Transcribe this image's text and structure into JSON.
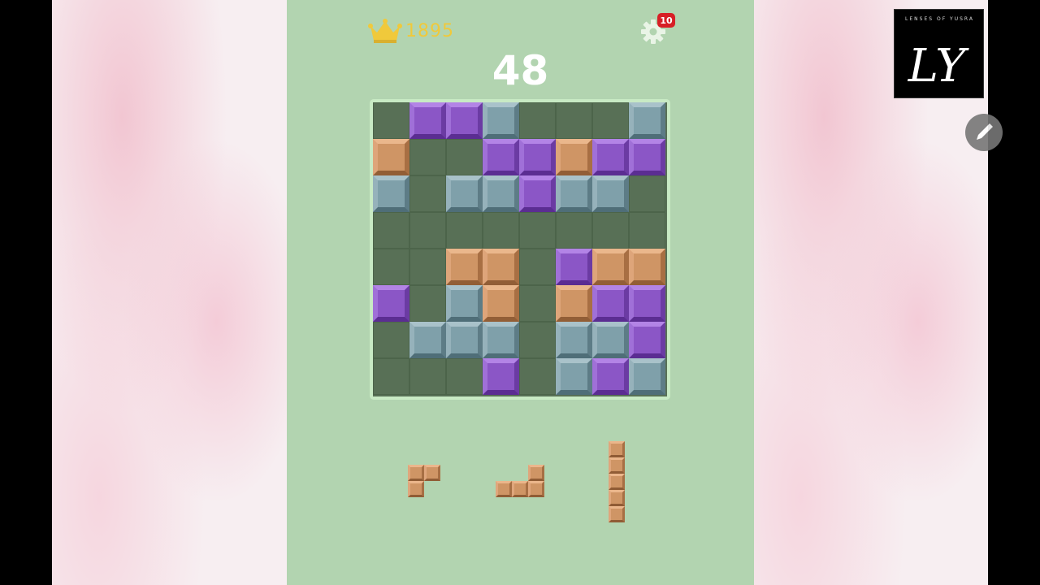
{
  "header": {
    "best_score": "1895",
    "current_score": "48",
    "notification_badge": "10",
    "crown_icon": "crown-icon",
    "settings_icon": "gear-icon"
  },
  "board": {
    "size": 8,
    "rows": [
      [
        "",
        "purple",
        "purple",
        "gray",
        "",
        "",
        "",
        "gray"
      ],
      [
        "tan",
        "",
        "",
        "purple",
        "purple",
        "tan",
        "purple",
        "purple"
      ],
      [
        "gray",
        "",
        "gray",
        "gray",
        "purple",
        "gray",
        "gray",
        ""
      ],
      [
        "",
        "",
        "",
        "",
        "",
        "",
        "",
        ""
      ],
      [
        "",
        "",
        "tan",
        "tan",
        "",
        "purple",
        "tan",
        "tan"
      ],
      [
        "purple",
        "",
        "gray",
        "tan",
        "",
        "tan",
        "purple",
        "purple"
      ],
      [
        "",
        "gray",
        "gray",
        "gray",
        "",
        "gray",
        "gray",
        "purple"
      ],
      [
        "",
        "",
        "",
        "purple",
        "",
        "gray",
        "purple",
        "gray"
      ]
    ]
  },
  "pieces": [
    {
      "name": "piece-corner",
      "color": "tan",
      "cells": [
        [
          0,
          0
        ],
        [
          0,
          1
        ],
        [
          1,
          0
        ]
      ]
    },
    {
      "name": "piece-l",
      "color": "tan",
      "cells": [
        [
          0,
          2
        ],
        [
          1,
          0
        ],
        [
          1,
          1
        ],
        [
          1,
          2
        ]
      ]
    },
    {
      "name": "piece-line",
      "color": "tan",
      "cells": [
        [
          0,
          0
        ],
        [
          1,
          0
        ],
        [
          2,
          0
        ],
        [
          3,
          0
        ],
        [
          4,
          0
        ]
      ]
    }
  ],
  "colors": {
    "game_background": "#b2d4b0",
    "board_empty": "#587056",
    "purple": "#8b56c6",
    "gray": "#7fa0aa",
    "tan": "#cf9565",
    "best_score_color": "#f0c93b",
    "badge_color": "#d71f26"
  },
  "overlay": {
    "watermark_text": "LENSES OF YUSRA",
    "watermark_monogram": "LY",
    "edit_icon": "pencil-icon"
  }
}
